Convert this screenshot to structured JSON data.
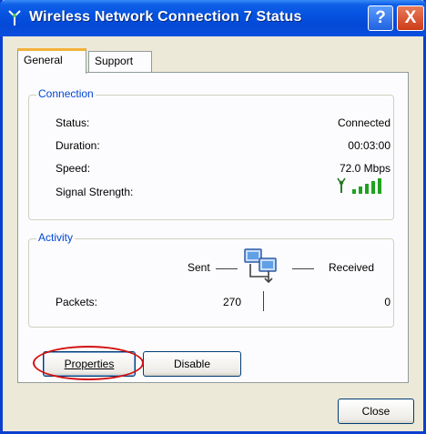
{
  "window": {
    "title": "Wireless Network Connection 7 Status",
    "help_button": "?",
    "close_button": "X"
  },
  "tabs": [
    {
      "label": "General",
      "active": true
    },
    {
      "label": "Support",
      "active": false
    }
  ],
  "connection": {
    "group_title": "Connection",
    "rows": [
      {
        "label": "Status:",
        "value": "Connected"
      },
      {
        "label": "Duration:",
        "value": "00:03:00"
      },
      {
        "label": "Speed:",
        "value": "72.0 Mbps"
      },
      {
        "label": "Signal Strength:",
        "value": "",
        "icon": "signal-strength-icon"
      }
    ]
  },
  "activity": {
    "group_title": "Activity",
    "sent_label": "Sent",
    "received_label": "Received",
    "packets_label": "Packets:",
    "packets_sent": "270",
    "packets_received": "0",
    "icon": "network-computers-icon"
  },
  "buttons": {
    "properties": "Properties",
    "disable": "Disable",
    "close": "Close"
  },
  "colors": {
    "title_bar": "#0553e0",
    "group_title": "#0046d5",
    "highlight_ellipse": "#d41010",
    "signal_bars": "#1fa31f"
  }
}
